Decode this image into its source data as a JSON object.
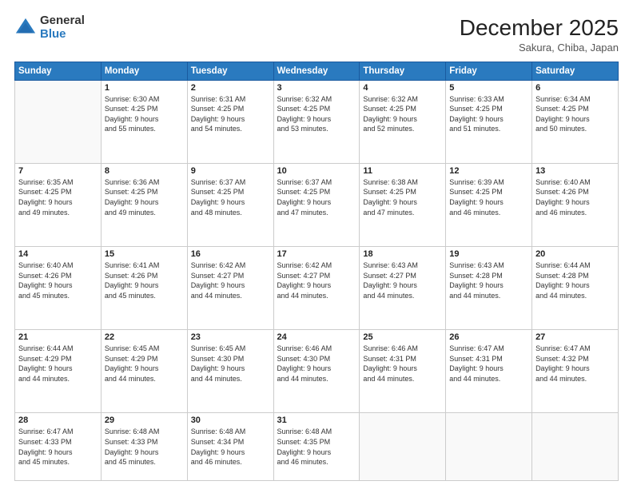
{
  "logo": {
    "general": "General",
    "blue": "Blue"
  },
  "title": "December 2025",
  "subtitle": "Sakura, Chiba, Japan",
  "days_header": [
    "Sunday",
    "Monday",
    "Tuesday",
    "Wednesday",
    "Thursday",
    "Friday",
    "Saturday"
  ],
  "weeks": [
    [
      {
        "day": "",
        "info": ""
      },
      {
        "day": "1",
        "info": "Sunrise: 6:30 AM\nSunset: 4:25 PM\nDaylight: 9 hours\nand 55 minutes."
      },
      {
        "day": "2",
        "info": "Sunrise: 6:31 AM\nSunset: 4:25 PM\nDaylight: 9 hours\nand 54 minutes."
      },
      {
        "day": "3",
        "info": "Sunrise: 6:32 AM\nSunset: 4:25 PM\nDaylight: 9 hours\nand 53 minutes."
      },
      {
        "day": "4",
        "info": "Sunrise: 6:32 AM\nSunset: 4:25 PM\nDaylight: 9 hours\nand 52 minutes."
      },
      {
        "day": "5",
        "info": "Sunrise: 6:33 AM\nSunset: 4:25 PM\nDaylight: 9 hours\nand 51 minutes."
      },
      {
        "day": "6",
        "info": "Sunrise: 6:34 AM\nSunset: 4:25 PM\nDaylight: 9 hours\nand 50 minutes."
      }
    ],
    [
      {
        "day": "7",
        "info": "Sunrise: 6:35 AM\nSunset: 4:25 PM\nDaylight: 9 hours\nand 49 minutes."
      },
      {
        "day": "8",
        "info": "Sunrise: 6:36 AM\nSunset: 4:25 PM\nDaylight: 9 hours\nand 49 minutes."
      },
      {
        "day": "9",
        "info": "Sunrise: 6:37 AM\nSunset: 4:25 PM\nDaylight: 9 hours\nand 48 minutes."
      },
      {
        "day": "10",
        "info": "Sunrise: 6:37 AM\nSunset: 4:25 PM\nDaylight: 9 hours\nand 47 minutes."
      },
      {
        "day": "11",
        "info": "Sunrise: 6:38 AM\nSunset: 4:25 PM\nDaylight: 9 hours\nand 47 minutes."
      },
      {
        "day": "12",
        "info": "Sunrise: 6:39 AM\nSunset: 4:25 PM\nDaylight: 9 hours\nand 46 minutes."
      },
      {
        "day": "13",
        "info": "Sunrise: 6:40 AM\nSunset: 4:26 PM\nDaylight: 9 hours\nand 46 minutes."
      }
    ],
    [
      {
        "day": "14",
        "info": "Sunrise: 6:40 AM\nSunset: 4:26 PM\nDaylight: 9 hours\nand 45 minutes."
      },
      {
        "day": "15",
        "info": "Sunrise: 6:41 AM\nSunset: 4:26 PM\nDaylight: 9 hours\nand 45 minutes."
      },
      {
        "day": "16",
        "info": "Sunrise: 6:42 AM\nSunset: 4:27 PM\nDaylight: 9 hours\nand 44 minutes."
      },
      {
        "day": "17",
        "info": "Sunrise: 6:42 AM\nSunset: 4:27 PM\nDaylight: 9 hours\nand 44 minutes."
      },
      {
        "day": "18",
        "info": "Sunrise: 6:43 AM\nSunset: 4:27 PM\nDaylight: 9 hours\nand 44 minutes."
      },
      {
        "day": "19",
        "info": "Sunrise: 6:43 AM\nSunset: 4:28 PM\nDaylight: 9 hours\nand 44 minutes."
      },
      {
        "day": "20",
        "info": "Sunrise: 6:44 AM\nSunset: 4:28 PM\nDaylight: 9 hours\nand 44 minutes."
      }
    ],
    [
      {
        "day": "21",
        "info": "Sunrise: 6:44 AM\nSunset: 4:29 PM\nDaylight: 9 hours\nand 44 minutes."
      },
      {
        "day": "22",
        "info": "Sunrise: 6:45 AM\nSunset: 4:29 PM\nDaylight: 9 hours\nand 44 minutes."
      },
      {
        "day": "23",
        "info": "Sunrise: 6:45 AM\nSunset: 4:30 PM\nDaylight: 9 hours\nand 44 minutes."
      },
      {
        "day": "24",
        "info": "Sunrise: 6:46 AM\nSunset: 4:30 PM\nDaylight: 9 hours\nand 44 minutes."
      },
      {
        "day": "25",
        "info": "Sunrise: 6:46 AM\nSunset: 4:31 PM\nDaylight: 9 hours\nand 44 minutes."
      },
      {
        "day": "26",
        "info": "Sunrise: 6:47 AM\nSunset: 4:31 PM\nDaylight: 9 hours\nand 44 minutes."
      },
      {
        "day": "27",
        "info": "Sunrise: 6:47 AM\nSunset: 4:32 PM\nDaylight: 9 hours\nand 44 minutes."
      }
    ],
    [
      {
        "day": "28",
        "info": "Sunrise: 6:47 AM\nSunset: 4:33 PM\nDaylight: 9 hours\nand 45 minutes."
      },
      {
        "day": "29",
        "info": "Sunrise: 6:48 AM\nSunset: 4:33 PM\nDaylight: 9 hours\nand 45 minutes."
      },
      {
        "day": "30",
        "info": "Sunrise: 6:48 AM\nSunset: 4:34 PM\nDaylight: 9 hours\nand 46 minutes."
      },
      {
        "day": "31",
        "info": "Sunrise: 6:48 AM\nSunset: 4:35 PM\nDaylight: 9 hours\nand 46 minutes."
      },
      {
        "day": "",
        "info": ""
      },
      {
        "day": "",
        "info": ""
      },
      {
        "day": "",
        "info": ""
      }
    ]
  ]
}
